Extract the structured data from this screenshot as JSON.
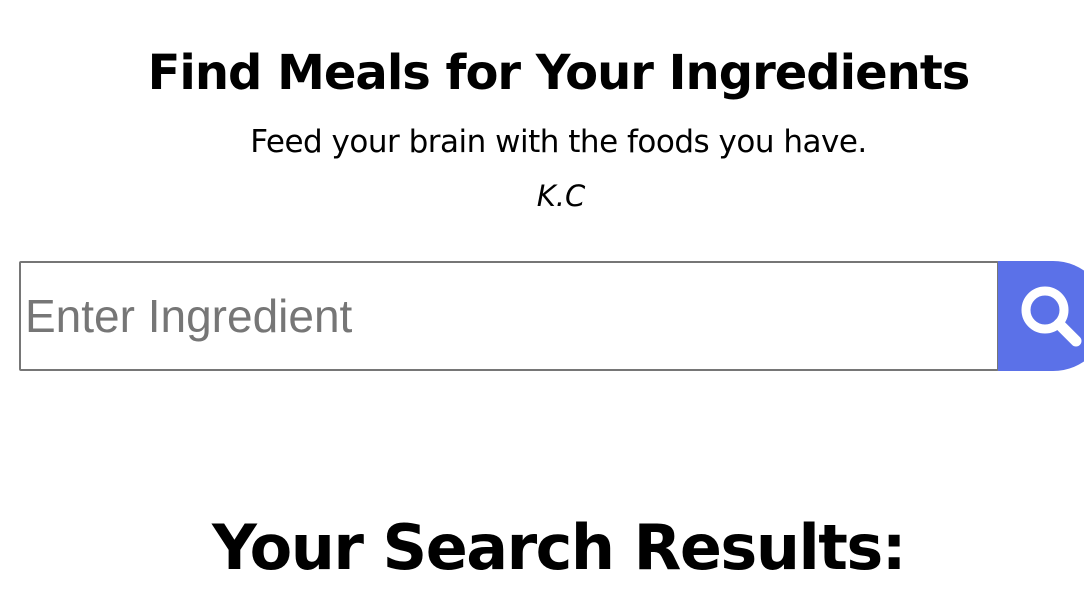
{
  "header": {
    "title": "Find Meals for Your Ingredients",
    "tagline": "Feed your brain with the foods you have.",
    "author": "K.C"
  },
  "search": {
    "placeholder": "Enter Ingredient",
    "value": "",
    "button_icon": "search-icon",
    "button_color": "#5b71e8"
  },
  "results": {
    "heading": "Your Search Results:"
  }
}
